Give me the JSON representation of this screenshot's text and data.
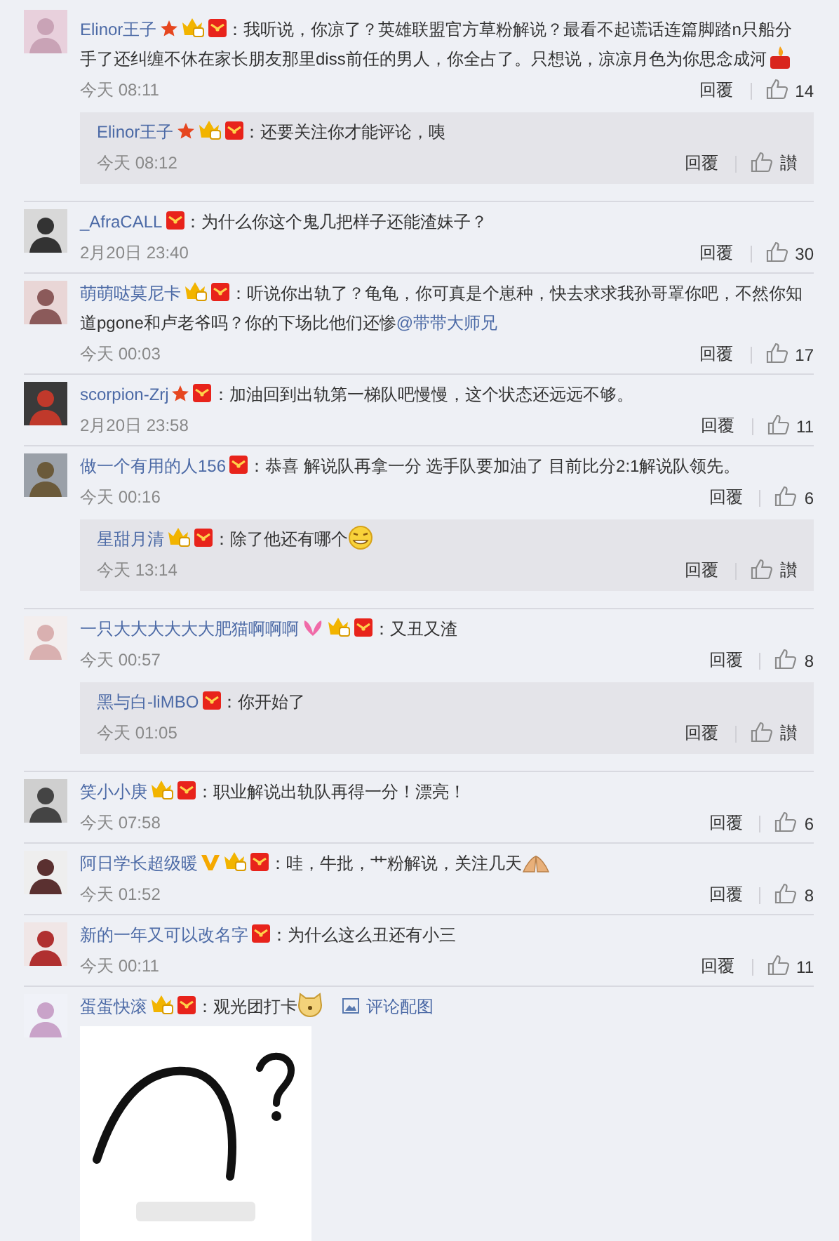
{
  "comments": [
    {
      "user": "Elinor王子",
      "badges": [
        {
          "kind": "star"
        },
        {
          "kind": "crown"
        },
        {
          "kind": "envelope"
        }
      ],
      "text": "：我听说，你凉了？英雄联盟官方草粉解说？最看不起谎话连篇脚踏n只船分",
      "text_continued": "手了还纠缠不休在家长朋友那里diss前任的男人，你全占了。只想说，凉凉月色为你思念成河",
      "emoji": {
        "kind": "candle"
      },
      "time": "今天 08:11",
      "reply_label": "回覆",
      "likes": "14",
      "replies": [
        {
          "user": "Elinor王子",
          "badges": [
            {
              "kind": "star"
            },
            {
              "kind": "crown"
            },
            {
              "kind": "envelope"
            }
          ],
          "text": "：还要关注你才能评论，咦",
          "time": "今天 08:12",
          "reply_label": "回覆",
          "likes": "讃"
        }
      ]
    },
    {
      "user": "_AfraCALL",
      "badges": [
        {
          "kind": "envelope"
        }
      ],
      "text": "：为什么你这个鬼几把样子还能渣妹子？",
      "time": "2月20日 23:40",
      "reply_label": "回覆",
      "likes": "30"
    },
    {
      "user": "萌萌哒莫尼卡",
      "badges": [
        {
          "kind": "crown"
        },
        {
          "kind": "envelope"
        }
      ],
      "text": "：听说你出轨了？龟龟，你可真是个崽种，快去求求我孙哥罩你吧，不然你知",
      "text_continued": "道pgone和卢老爷吗？你的下场比他们还惨",
      "mention": "@带带大师兄",
      "time": "今天 00:03",
      "reply_label": "回覆",
      "likes": "17"
    },
    {
      "user": "scorpion-Zrj",
      "badges": [
        {
          "kind": "star"
        },
        {
          "kind": "envelope"
        }
      ],
      "text": "：加油回到出轨第一梯队吧慢慢，这个状态还远远不够。",
      "time": "2月20日 23:58",
      "reply_label": "回覆",
      "likes": "11"
    },
    {
      "user": "做一个有用的人156",
      "badges": [
        {
          "kind": "envelope"
        }
      ],
      "text": "：恭喜 解说队再拿一分 选手队要加油了 目前比分2:1解说队领先。",
      "time": "今天 00:16",
      "reply_label": "回覆",
      "likes": "6",
      "replies": [
        {
          "user": "星甜月清",
          "badges": [
            {
              "kind": "crown"
            },
            {
              "kind": "envelope"
            }
          ],
          "text": "：除了他还有哪个",
          "emoji": {
            "kind": "grin"
          },
          "time": "今天 13:14",
          "reply_label": "回覆",
          "likes": "讃"
        }
      ]
    },
    {
      "user": "一只大大大大大大肥猫啊啊啊",
      "badges": [
        {
          "kind": "bow"
        },
        {
          "kind": "crown"
        },
        {
          "kind": "envelope"
        }
      ],
      "text": "：又丑又渣",
      "time": "今天 00:57",
      "reply_label": "回覆",
      "likes": "8",
      "replies": [
        {
          "user": "黑与白-liMBO",
          "badges": [
            {
              "kind": "envelope"
            }
          ],
          "text": "：你开始了",
          "time": "今天 01:05",
          "reply_label": "回覆",
          "likes": "讃"
        }
      ]
    },
    {
      "user": "笑小小庚",
      "badges": [
        {
          "kind": "crown"
        },
        {
          "kind": "envelope"
        }
      ],
      "text": "：职业解说出轨队再得一分！漂亮！",
      "time": "今天 07:58",
      "reply_label": "回覆",
      "likes": "6"
    },
    {
      "user": "阿日学长超级暖",
      "badges": [
        {
          "kind": "vip"
        },
        {
          "kind": "crown"
        },
        {
          "kind": "envelope"
        }
      ],
      "text": "：哇，牛批，艹粉解说，关注几天",
      "emoji": {
        "kind": "hands"
      },
      "time": "今天 01:52",
      "reply_label": "回覆",
      "likes": "8"
    },
    {
      "user": "新的一年又可以改名字",
      "badges": [
        {
          "kind": "envelope"
        }
      ],
      "text": "：为什么这么丑还有小三",
      "time": "今天 00:11",
      "reply_label": "回覆",
      "likes": "11"
    },
    {
      "user": "蛋蛋快滚",
      "badges": [
        {
          "kind": "crown"
        },
        {
          "kind": "envelope"
        }
      ],
      "text": "：观光团打卡",
      "emoji": {
        "kind": "dog"
      },
      "attachment_link": "评论配图",
      "attachment": {
        "kind": "picture"
      }
    }
  ]
}
